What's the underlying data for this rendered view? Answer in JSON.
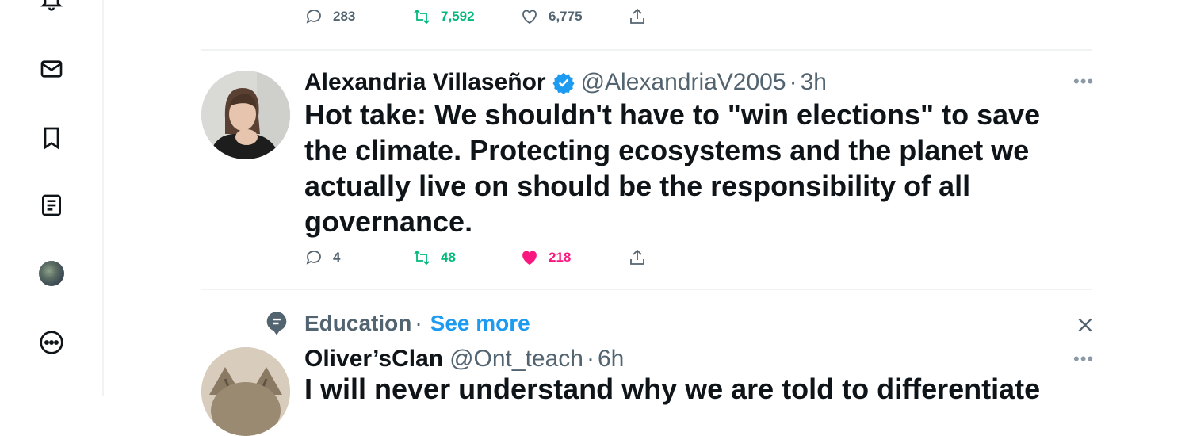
{
  "sidebar": {
    "icons": [
      "bell-icon",
      "mail-icon",
      "bookmark-icon",
      "lists-icon",
      "profile-avatar",
      "more-icon"
    ]
  },
  "prev_tweet": {
    "replies": "283",
    "retweets": "7,592",
    "likes": "6,775"
  },
  "tweet": {
    "name": "Alexandria Villaseñor",
    "handle": "@AlexandriaV2005",
    "dot": "·",
    "time": "3h",
    "text": "Hot take: We shouldn't have to \"win elections\" to save the climate. Protecting ecosystems and the planet we actually live on should be the responsibility of all governance.",
    "replies": "4",
    "retweets": "48",
    "likes": "218"
  },
  "topic": {
    "label": "Education",
    "dot": "·",
    "link": "See more"
  },
  "next_tweet": {
    "name": "Oliver’sClan",
    "handle": "@Ont_teach",
    "dot": "·",
    "time": "6h",
    "text": "I will never understand why we are told to differentiate"
  },
  "colors": {
    "accent": "#1d9bf0",
    "retweet": "#00ba7c",
    "like": "#f91880",
    "muted": "#536471"
  }
}
